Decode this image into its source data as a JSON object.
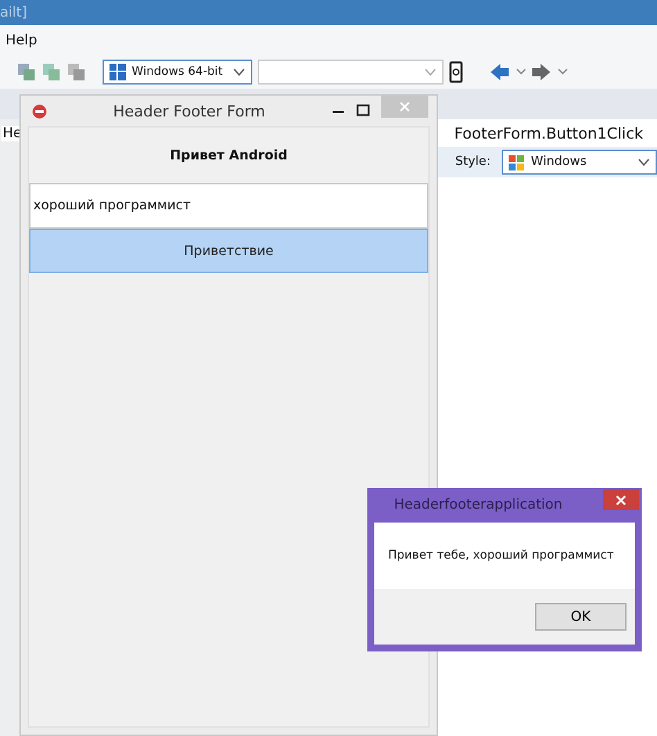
{
  "ide": {
    "title": "ailt]",
    "menu": [
      "Help"
    ],
    "platform_combo": "Windows 64-bit",
    "editor_left_text": "He",
    "editor_right_text": "FooterForm.Button1Click",
    "style_label": "Style:",
    "style_combo": "Windows"
  },
  "form_window": {
    "title": "Header Footer Form",
    "label": "Привет Android",
    "edit_value": "хороший программист",
    "button": "Приветствие"
  },
  "dialog": {
    "title": "Headerfooterapplication",
    "message": "Привет тебе, хороший программист",
    "button": "OK"
  }
}
